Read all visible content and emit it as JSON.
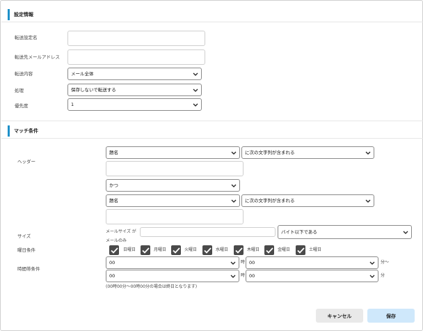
{
  "sections": {
    "settings": "設定情報",
    "match": "マッチ条件"
  },
  "fields": {
    "forward_name_label": "転送設定名",
    "forward_name_value": "",
    "forward_email_label": "転送先メールアドレス",
    "forward_email_value": "",
    "content_label": "転送内容",
    "content_value": "メール全体",
    "keep_label": "処理",
    "keep_value": "保存しないで転送する",
    "priority_label": "優先度",
    "priority_value": "1"
  },
  "match": {
    "header_label": "ヘッダー",
    "cond1_field": "題名",
    "cond1_op": "に次の文字列が含まれる",
    "cond1_text": "",
    "conjunction": "かつ",
    "cond2_field": "題名",
    "cond2_op": "に次の文字列が含まれる",
    "cond2_text": "",
    "size_label": "サイズ",
    "size_prefix": "メールサイズ が",
    "size_value": "",
    "size_unit": "バイト以下である",
    "size_note": "メールのみ",
    "weekday_label": "曜日条件",
    "weekdays": [
      "日曜日",
      "月曜日",
      "火曜日",
      "水曜日",
      "木曜日",
      "金曜日",
      "土曜日"
    ],
    "time_label": "時間帯条件",
    "time_from_hour": "00",
    "time_from_min": "00",
    "time_to_hour": "00",
    "time_to_min": "00",
    "hour_unit": "時",
    "min_unit_from": "分〜",
    "min_unit_to": "分",
    "time_note": "(00時00分〜00時00分の場合は終日となります)"
  },
  "buttons": {
    "cancel": "キャンセル",
    "save": "保存"
  },
  "colors": {
    "accent": "#1e90c9",
    "save_bg": "#cfe8fb",
    "cancel_bg": "#e9e9e9"
  }
}
